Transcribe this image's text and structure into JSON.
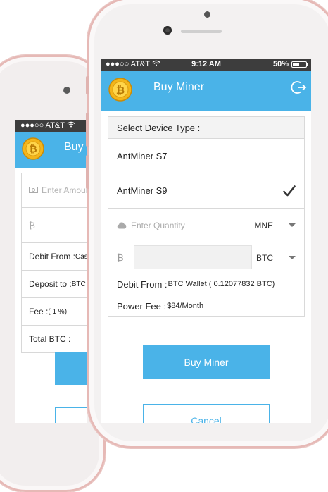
{
  "status": {
    "carrier": "●●●○○ AT&T",
    "time": "9:12 AM",
    "battery": "50%",
    "battery_level": 0.5
  },
  "header": {
    "title": "Buy Miner"
  },
  "form": {
    "device_type_label": "Select Device Type :",
    "devices": [
      {
        "label": "AntMiner S7",
        "selected": false
      },
      {
        "label": "AntMiner S9",
        "selected": true
      }
    ],
    "quantity_placeholder": "Enter Quantity",
    "quantity_unit": "MNE",
    "btc_symbol": "₿",
    "btc_unit": "BTC",
    "debit_from_label": "Debit From :",
    "debit_from_value": "BTC Wallet ( 0.12077832 BTC)",
    "power_fee_label": "Power Fee :",
    "power_fee_value": "$84/Month"
  },
  "buttons": {
    "buy": "Buy Miner",
    "cancel": "Cancel"
  },
  "back_phone": {
    "carrier": "●●●○○ AT&T",
    "title": "Buy B",
    "amount_placeholder": "Enter Amount",
    "btc_symbol": "₿",
    "debit_from_label": "Debit From :",
    "debit_from_value": "Cash",
    "deposit_to_label": "Deposit to :",
    "deposit_to_value": "BTC W",
    "fee_label": "Fee :",
    "fee_value": "( 1 %)",
    "total_label": "Total BTC :"
  },
  "colors": {
    "accent": "#4ab3e8",
    "status_bar": "#3d3d3d",
    "frame": "#e6b9b6"
  }
}
